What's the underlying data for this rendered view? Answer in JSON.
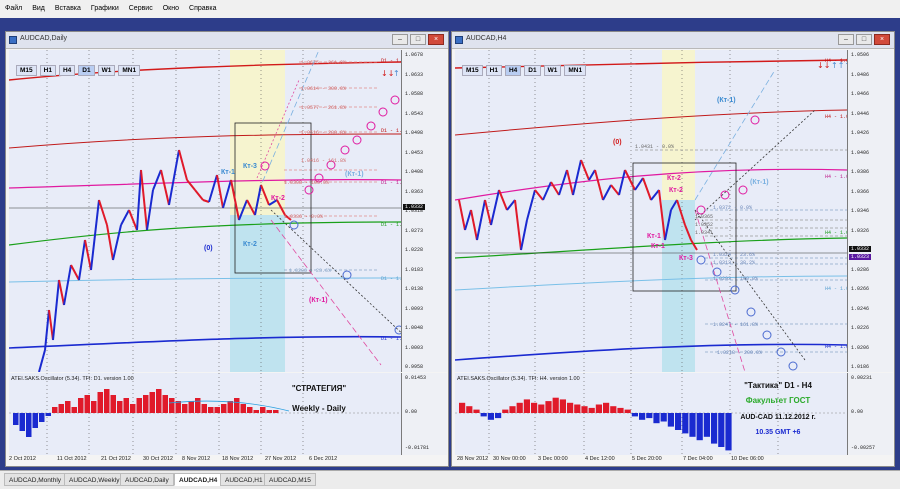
{
  "menu": [
    "Файл",
    "Вид",
    "Вставка",
    "Графики",
    "Сервис",
    "Окно",
    "Справка"
  ],
  "timeframes": [
    "M15",
    "H1",
    "H4",
    "D1",
    "W1",
    "MN1"
  ],
  "left": {
    "title": "AUDCAD,Daily",
    "active_tf": "D1",
    "yticks": [
      "1.0678",
      "1.0633",
      "1.0588",
      "1.0543",
      "1.0498",
      "1.0453",
      "1.0408",
      "1.0363",
      "1.0318",
      "1.0273",
      "1.0228",
      "1.0183",
      "1.0138",
      "1.0093",
      "1.0048",
      "1.0003",
      "0.9958"
    ],
    "xticks": [
      "2 Oct 2012",
      "11 Oct 2012",
      "21 Oct 2012",
      "30 Oct 2012",
      "8 Nov 2012",
      "18 Nov 2012",
      "27 Nov 2012",
      "6 Dec 2012"
    ],
    "price": "1.0332",
    "levels": [
      {
        "text": "1.0675 - 361.8%",
        "color": "#d06a6a"
      },
      {
        "text": "1.0614 - 300.0%",
        "color": "#d06a6a"
      },
      {
        "text": "1.0577 - 261.8%",
        "color": "#d06a6a"
      },
      {
        "text": "1.0516 - 200.0%",
        "color": "#d06a6a"
      },
      {
        "text": "1.0416 - 161.8%",
        "color": "#d06a6a"
      },
      {
        "text": "1.0398 - 100.0%",
        "color": "#d06a6a"
      },
      {
        "text": "1.0336 - 0.0%",
        "color": "#d06a6a"
      },
      {
        "text": "1.0206 - 23.6%",
        "color": "#8aa6c8"
      }
    ],
    "rlabels": [
      {
        "text": "D1 - 1.0664",
        "color": "#c01010"
      },
      {
        "text": "D1 - 1.0556",
        "color": "#c01010"
      },
      {
        "text": "D1 - 1.0429",
        "color": "#c01a8a"
      },
      {
        "text": "D1 - 1.0302",
        "color": "#1a9a1a"
      },
      {
        "text": "D1 - 1.0176",
        "color": "#5aa0d0"
      },
      {
        "text": "D1 - 1.0049",
        "color": "#1a2ad0"
      }
    ],
    "kt": {
      "kt3": "Кт-3",
      "kt1": "Кт-1",
      "kt2top": "Кт-2",
      "kt2bot": "Кт-2",
      "kt1r": "(Кт-1)",
      "kt1d": "(Кт-1)",
      "zero": "(0)"
    },
    "osc": {
      "title": "ATEI.SAKS.Oscillator (5.34). TFI: D1. version 1.00",
      "vals": [
        "0.01453",
        "0.00",
        "-0.01781"
      ]
    },
    "strategy": [
      "\"СТРАТЕГИЯ\"",
      "Weekly - Daily"
    ]
  },
  "right": {
    "title": "AUDCAD,H4",
    "active_tf": "H4",
    "yticks": [
      "1.0506",
      "1.0486",
      "1.0466",
      "1.0446",
      "1.0426",
      "1.0406",
      "1.0386",
      "1.0366",
      "1.0346",
      "1.0326",
      "1.0306",
      "1.0286",
      "1.0266",
      "1.0246",
      "1.0226",
      "1.0206",
      "1.0186"
    ],
    "xticks": [
      "28 Nov 2012",
      "30 Nov 00:00",
      "3 Dec 00:00",
      "4 Dec 12:00",
      "5 Dec 20:00",
      "7 Dec 04:00",
      "10 Dec 06:00"
    ],
    "prices": [
      "1.0332",
      "1.0323"
    ],
    "levels": [
      {
        "text": "1.0431 - 0.0%",
        "color": "#666"
      },
      {
        "text": "1.0372 - 0.0%",
        "color": "#6a86b8"
      },
      {
        "text": "1.0365",
        "color": "#666"
      },
      {
        "text": "1.0352",
        "color": "#666"
      },
      {
        "text": "1.0341",
        "color": "#666"
      },
      {
        "text": "1.0324 - 23.6%",
        "color": "#6a86b8"
      },
      {
        "text": "1.0313 - 38.2%",
        "color": "#6a86b8"
      },
      {
        "text": "1.0293 - 100.0%",
        "color": "#6a86b8"
      },
      {
        "text": "1.0247 - 161.8%",
        "color": "#6a86b8"
      },
      {
        "text": "1.0218 - 200.0%",
        "color": "#6a86b8"
      }
    ],
    "rlabels": [
      {
        "text": "H4 - 1.0527",
        "color": "#c01010"
      },
      {
        "text": "H4 - 1.0463",
        "color": "#c01010"
      },
      {
        "text": "H4 - 1.0398",
        "color": "#c01a8a"
      },
      {
        "text": "H4 - 1.0333",
        "color": "#1a9a1a"
      },
      {
        "text": "H4 - 1.0269",
        "color": "#5aa0d0"
      },
      {
        "text": "H4 - 1.0204",
        "color": "#1a2ad0"
      }
    ],
    "kt": {
      "kt1top": "(Кт-1)",
      "zero": "(0)",
      "kt2a": "Кт-2",
      "kt2b": "Кт-2",
      "kt1a": "Кт-1",
      "kt1b": "Кт-1",
      "kt3": "Кт-3",
      "kt1r": "(Кт-1)"
    },
    "osc": {
      "title": "ATEI.SAKS.Oscillator (5.34). TFI: H4. version 1.00",
      "vals": [
        "0.00231",
        "0.00",
        "-0.00257"
      ]
    },
    "tactic": [
      "\"Тактика\"  D1 - H4",
      "Факультет ГОСТ",
      "AUD-CAD  11.12.2012  г.",
      "10.35   GMT +6"
    ]
  },
  "tabs": [
    "AUDCAD,Monthly",
    "AUDCAD,Weekly",
    "AUDCAD,Daily",
    "AUDCAD,H4",
    "AUDCAD,H1",
    "AUDCAD,M15"
  ],
  "active_tab": "AUDCAD,H4",
  "colors": {
    "up": "#1a2ad0",
    "down": "#e01a2a",
    "osc_up": "#e01a2a",
    "osc_down": "#1a2ad0"
  }
}
